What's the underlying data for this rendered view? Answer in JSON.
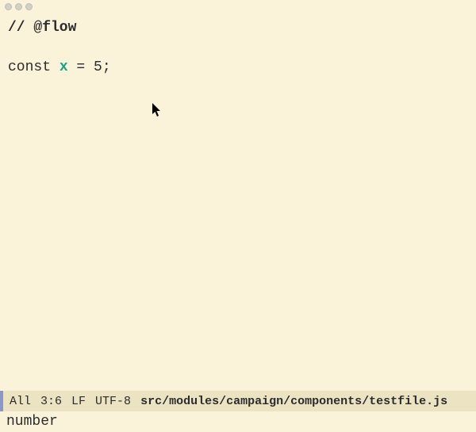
{
  "titlebar": {
    "traffic_lights": [
      "close",
      "minimize",
      "zoom"
    ]
  },
  "editor": {
    "lines": {
      "comment": "// @flow",
      "blank": "",
      "decl_keyword": "const ",
      "decl_identifier": "x",
      "decl_rest": " = 5;"
    }
  },
  "statusbar": {
    "mode": "All",
    "position": "3:6",
    "eol": "LF",
    "encoding": "UTF-8",
    "filepath": "src/modules/campaign/components/testfile.js"
  },
  "minibuffer": {
    "message": "number"
  }
}
